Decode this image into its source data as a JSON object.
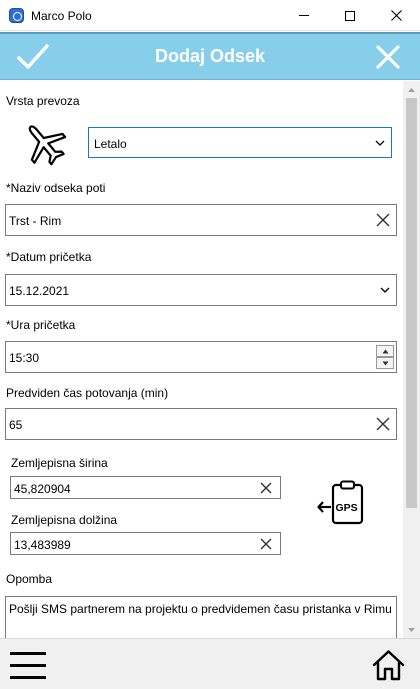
{
  "window": {
    "title": "Marco Polo",
    "icons": {
      "app": "globe-app-icon",
      "minimize": "minimize-icon",
      "maximize": "maximize-icon",
      "close": "close-icon"
    }
  },
  "header": {
    "title": "Dodaj Odsek",
    "background_color": "#87ceeb",
    "confirm_icon": "check-icon",
    "close_icon": "close-x-icon"
  },
  "form": {
    "transport": {
      "label": "Vrsta prevoza",
      "icon": "airplane-icon",
      "selected": "Letalo"
    },
    "segment_name": {
      "label": "*Naziv odseka poti",
      "value": "Trst - Rim"
    },
    "start_date": {
      "label": "*Datum pričetka",
      "value": "15.12.2021"
    },
    "start_time": {
      "label": "*Ura pričetka",
      "value": "15:30"
    },
    "duration": {
      "label": "Predviden čas potovanja (min)",
      "value": "65"
    },
    "latitude": {
      "label": "Zemljepisna širina",
      "value": "45,820904"
    },
    "longitude": {
      "label": "Zemljepisna dolžina",
      "value": "13,483989"
    },
    "gps_button": {
      "icon": "gps-clipboard-icon",
      "label": "GPS"
    },
    "note": {
      "label": "Opomba",
      "value": "Pošlji SMS partnerem na projektu o predvidemen času pristanka v Rimu"
    }
  },
  "bottom_bar": {
    "menu_icon": "hamburger-menu-icon",
    "home_icon": "home-icon"
  }
}
